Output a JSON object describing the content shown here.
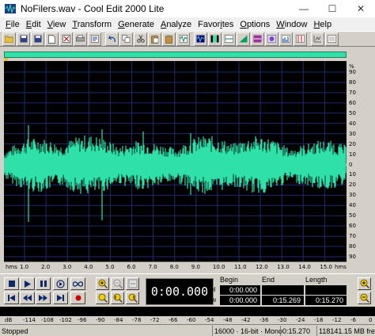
{
  "window": {
    "title": "NoFilers.wav - Cool Edit 2000 Lite",
    "minimize_glyph": "—",
    "maximize_glyph": "☐",
    "close_glyph": "✕"
  },
  "menu": [
    {
      "pre": "",
      "u": "F",
      "post": "ile"
    },
    {
      "pre": "",
      "u": "E",
      "post": "dit"
    },
    {
      "pre": "",
      "u": "V",
      "post": "iew"
    },
    {
      "pre": "",
      "u": "T",
      "post": "ransform"
    },
    {
      "pre": "",
      "u": "G",
      "post": "enerate"
    },
    {
      "pre": "",
      "u": "A",
      "post": "nalyze"
    },
    {
      "pre": "Favor",
      "u": "i",
      "post": "tes"
    },
    {
      "pre": "",
      "u": "O",
      "post": "ptions"
    },
    {
      "pre": "",
      "u": "W",
      "post": "indow"
    },
    {
      "pre": "",
      "u": "H",
      "post": "elp"
    }
  ],
  "db_scale": {
    "unit": "%",
    "labels": [
      "90",
      "80",
      "70",
      "60",
      "50",
      "40",
      "30",
      "20",
      "10",
      "0",
      "10",
      "20",
      "30",
      "40",
      "50",
      "60",
      "70",
      "80",
      "90"
    ]
  },
  "time_ruler": {
    "unit_left": "hms",
    "unit_right": "hms",
    "labels": [
      "1.0",
      "2.0",
      "3.0",
      "4.0",
      "5.0",
      "6.0",
      "7.0",
      "8.0",
      "9.0",
      "10.0",
      "11.0",
      "12.0",
      "13.0",
      "14.0",
      "15.0"
    ]
  },
  "time_display": "0:00.000",
  "selection": {
    "headers": [
      "Begin",
      "End",
      "Length"
    ],
    "row_labels": [
      "Sel",
      "View"
    ],
    "sel": [
      "0:00.000",
      "",
      ""
    ],
    "view": [
      "0:00.000",
      "0:15.269",
      "0:15.270"
    ]
  },
  "meter": {
    "labels": [
      "dB",
      "-114",
      "-108",
      "-102",
      "-96",
      "-90",
      "-84",
      "-78",
      "-72",
      "-66",
      "-60",
      "-54",
      "-48",
      "-42",
      "-36",
      "-30",
      "-24",
      "-18",
      "-12",
      "-6",
      "0"
    ]
  },
  "status": {
    "state": "Stopped",
    "format": "16000 · 16-bit · Mono",
    "duration": "0:15.270",
    "free_space": "118141.15 MB fre"
  },
  "colors": {
    "waveform": "#2fe0a8",
    "background": "#000000",
    "grid": "#1e2a6e",
    "panel": "#d4d0c8"
  }
}
